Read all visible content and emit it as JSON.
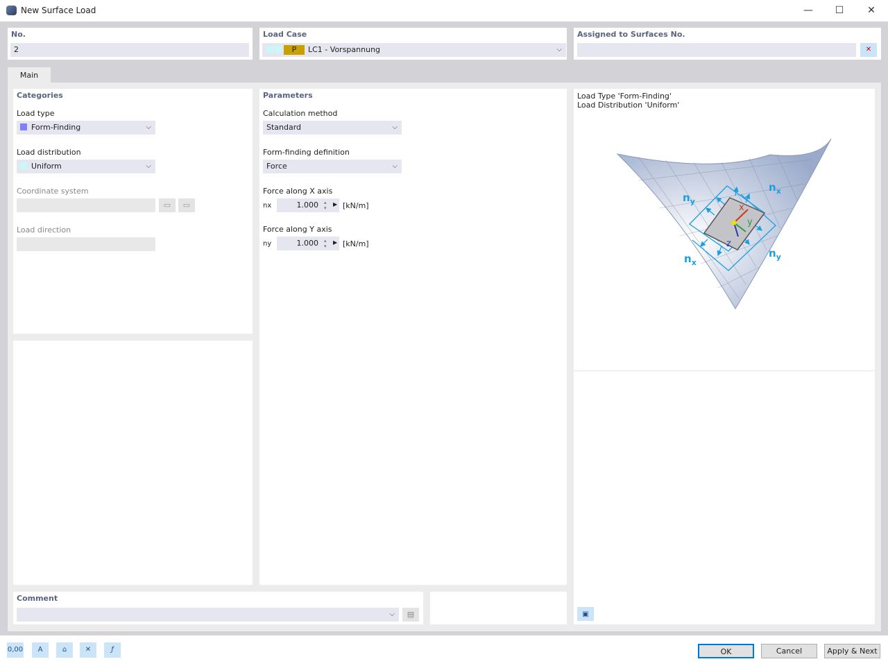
{
  "window": {
    "title": "New Surface Load",
    "minimize": "—",
    "maximize": "☐",
    "close": "✕"
  },
  "no": {
    "label": "No.",
    "value": "2"
  },
  "load_case": {
    "label": "Load Case",
    "badge": "P",
    "value": "LC1 - Vorspannung",
    "badge_color": "#c8a000",
    "swatch_color": "#c8f8f8"
  },
  "assigned": {
    "label": "Assigned to Surfaces No.",
    "value": ""
  },
  "tabs": [
    {
      "label": "Main"
    }
  ],
  "categories": {
    "title": "Categories",
    "load_type_label": "Load type",
    "load_type": "Form-Finding",
    "load_type_color": "#8080ff",
    "load_distribution_label": "Load distribution",
    "load_distribution": "Uniform",
    "coordinate_system_label": "Coordinate system",
    "coordinate_system": "",
    "load_direction_label": "Load direction",
    "load_direction": ""
  },
  "parameters": {
    "title": "Parameters",
    "calc_method_label": "Calculation method",
    "calc_method": "Standard",
    "ff_def_label": "Form-finding definition",
    "ff_def": "Force",
    "fx_label": "Force along X axis",
    "fx_sym": "nx",
    "fx_value": "1.000",
    "fx_unit": "[kN/m]",
    "fy_label": "Force along Y axis",
    "fy_sym": "ny",
    "fy_value": "1.000",
    "fy_unit": "[kN/m]"
  },
  "preview": {
    "line1": "Load Type 'Form-Finding'",
    "line2": "Load Distribution 'Uniform'",
    "labels": {
      "nx": "n",
      "ny": "n",
      "x": "x",
      "y": "y",
      "z": "z",
      "sx": "x",
      "sy": "y"
    }
  },
  "comment": {
    "label": "Comment",
    "value": ""
  },
  "footer": {
    "icons": [
      "0,00",
      "A",
      "",
      "",
      ""
    ],
    "ok": "OK",
    "cancel": "Cancel",
    "apply_next": "Apply & Next"
  }
}
